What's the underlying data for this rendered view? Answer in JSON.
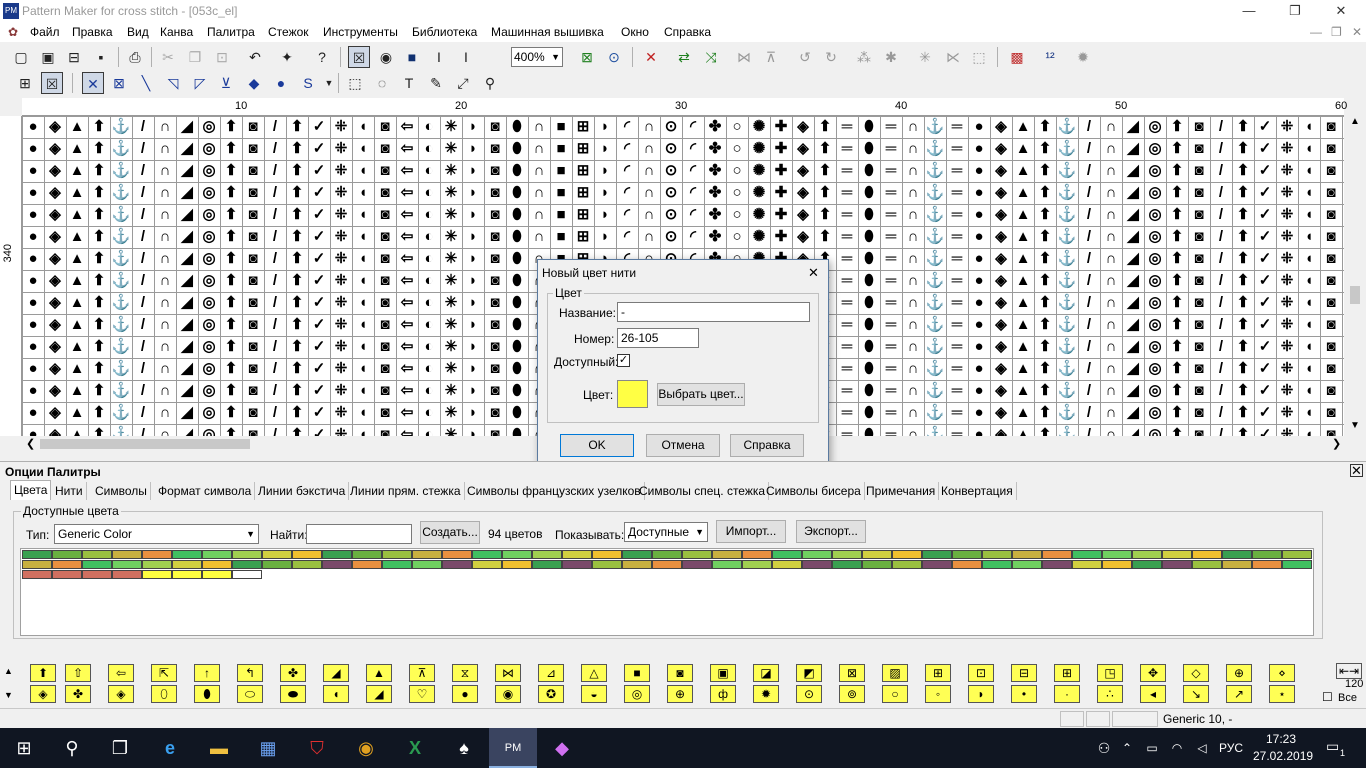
{
  "app": {
    "title": "Pattern Maker for cross stitch - [053c_el]",
    "icon_text": "PM"
  },
  "window_controls": [
    "—",
    "❐",
    "✕"
  ],
  "menu": [
    "Файл",
    "Правка",
    "Вид",
    "Канва",
    "Палитра",
    "Стежок",
    "Инструменты",
    "Библиотека",
    "Машинная вышивка",
    "Окно",
    "Справка"
  ],
  "mdi_controls": [
    "—",
    "❐",
    "✕"
  ],
  "toolbar1": {
    "zoom": "400%"
  },
  "ruler": {
    "top": [
      "10",
      "20",
      "30",
      "40",
      "50",
      "60"
    ],
    "left": "340"
  },
  "grid_symbols": "●═✤⊞✳✓◢◈⬮○◗◗⁜◎▲═✺◜◙◖⬆⬆∩✚∩⬮◙◙⚓⚓◈⊙∩⇦//═⬆◜■◐⬆∩",
  "dialog": {
    "title": "Новый цвет нити",
    "close": "✕",
    "group": "Цвет",
    "name_label": "Название:",
    "name_value": "-",
    "number_label": "Номер:",
    "number_value": "26-105",
    "available_label": "Доступный:",
    "available_check": "✓",
    "color_label": "Цвет:",
    "color_value": "#ffff44",
    "choose_color": "Выбрать цвет...",
    "ok": "OK",
    "cancel": "Отмена",
    "help": "Справка"
  },
  "palette": {
    "title": "Опции Палитры",
    "close": "✕",
    "tabs": [
      "Цвета",
      "Нити",
      "Символы",
      "Формат символа",
      "Линии бэкстича",
      "Линии прям. стежка",
      "Символы французских узелков",
      "Символы спец. стежка",
      "Символы бисера",
      "Примечания",
      "Конвертация"
    ],
    "group": "Доступные цвета",
    "type_label": "Тип:",
    "type_value": "Generic Color",
    "find_label": "Найти:",
    "find_value": "",
    "create": "Создать...",
    "count": "94 цветов",
    "show_label": "Показывать:",
    "show_value": "Доступные",
    "import": "Импорт...",
    "export": "Экспорт..."
  },
  "symbar": {
    "size": "120",
    "all_label": "Все",
    "all_check": "☐"
  },
  "status": {
    "text": "Generic  10, -"
  },
  "taskbar": {
    "lang": "РУС",
    "time": "17:23",
    "date": "27.02.2019",
    "notif": "1"
  }
}
